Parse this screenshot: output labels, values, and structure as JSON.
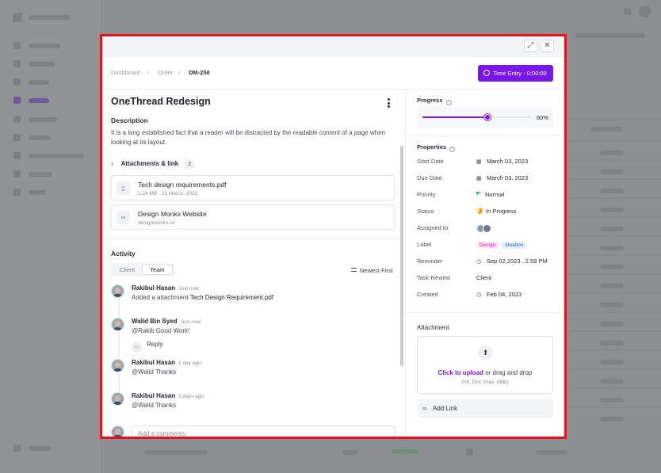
{
  "breadcrumb": [
    "Dashboard",
    "Order",
    "DM-258"
  ],
  "time_entry_label": "Time Entry - 0:00:00",
  "task": {
    "title": "OneThread Redesign",
    "description_heading": "Description",
    "description": "It is a long established fact that a reader will be distracted by the readable content of a page when looking at its layout."
  },
  "attachments": {
    "heading": "Attachments & link",
    "count": "2",
    "items": [
      {
        "name": "Tech design requirements.pdf",
        "meta": "1.24 MB · 21 March, 2023",
        "icon": "file-icon"
      },
      {
        "name": "Design Monks Website",
        "meta": "designmonks.co",
        "icon": "link-icon"
      }
    ]
  },
  "activity": {
    "heading": "Activity",
    "tabs": [
      "Client",
      "Team"
    ],
    "active_tab": "Team",
    "sort_label": "Newest First",
    "entries": [
      {
        "name": "Rakibul Hasan",
        "time": "Just now",
        "text": "Added a attachment ",
        "highlight": "Tech Design Requirement.pdf"
      },
      {
        "name": "Walid Bin Syed",
        "time": "Just now",
        "text": "@Rakib Good Work!",
        "reply_label": "Reply"
      },
      {
        "name": "Rakibul Hasan",
        "time": "1 day ago",
        "text": "@Walid Thanks"
      },
      {
        "name": "Rakibul Hasan",
        "time": "3 days ago",
        "text": "@Walid Thanks"
      }
    ],
    "comment_placeholder": "Add a comments"
  },
  "progress": {
    "label": "Progress",
    "value": 0.6,
    "value_text": "60%"
  },
  "properties": {
    "heading": "Properties",
    "start_date": {
      "label": "Start Date",
      "value": "March 03, 2023"
    },
    "due_date": {
      "label": "Due Date",
      "value": "March 03, 2023"
    },
    "priority": {
      "label": "Priority",
      "value": "Normal"
    },
    "status": {
      "label": "Status",
      "value": "In Progress"
    },
    "assigned": {
      "label": "Assigned to"
    },
    "label": {
      "label": "Label",
      "tags": [
        "Design",
        "Ideation"
      ]
    },
    "reminder": {
      "label": "Reminder",
      "value": "Sep 02,2023 . 2.59 PM"
    },
    "task_review": {
      "label": "Task Review",
      "value": "Client"
    },
    "created": {
      "label": "Created",
      "value": "Feb 04, 2023"
    }
  },
  "upload": {
    "heading": "Attachment",
    "click_text": "Click to upload",
    "rest_text": " or drag and drop",
    "hint": "Pdf, Doc  (max. 5Mb)"
  },
  "add_link_label": "Add Link",
  "colors": {
    "accent": "#7b16e8",
    "highlight_border": "#e4141b",
    "priority_flag": "#12b24a",
    "status_in_progress": "#f2a900"
  }
}
